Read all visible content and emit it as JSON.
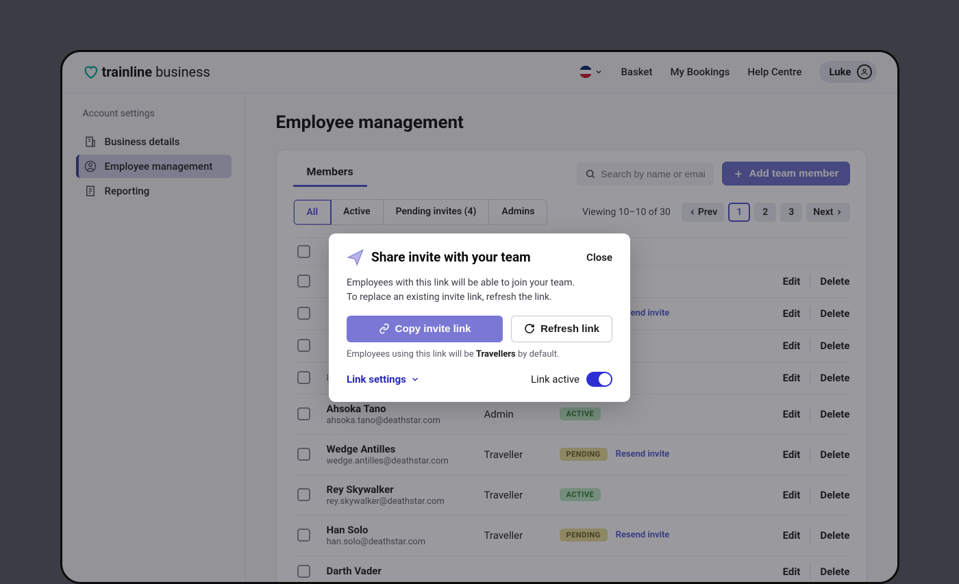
{
  "brand": {
    "primary": "trainline",
    "secondary": "business"
  },
  "topnav": {
    "basket": "Basket",
    "bookings": "My Bookings",
    "help": "Help Centre",
    "user_name": "Luke"
  },
  "sidebar": {
    "heading": "Account settings",
    "items": [
      {
        "label": "Business details"
      },
      {
        "label": "Employee management"
      },
      {
        "label": "Reporting"
      }
    ]
  },
  "page": {
    "title": "Employee management"
  },
  "members_tab": "Members",
  "search_placeholder": "Search by name or email",
  "add_button": "Add team member",
  "filters": {
    "all": "All",
    "active": "Active",
    "pending": "Pending invites (4)",
    "admins": "Admins"
  },
  "viewing": "Viewing 10–10 of 30",
  "pagination": {
    "prev": "Prev",
    "p1": "1",
    "p2": "2",
    "p3": "3",
    "next": "Next"
  },
  "actions": {
    "edit": "Edit",
    "delete": "Delete",
    "resend": "Resend invite"
  },
  "badges": {
    "active": "ACTIVE",
    "pending": "PENDING"
  },
  "rows": [
    {
      "name": "",
      "email": "",
      "role": "",
      "status": ""
    },
    {
      "name": "",
      "email": "",
      "role": "",
      "status": ""
    },
    {
      "name": "",
      "email": "",
      "role": "",
      "status": "pending"
    },
    {
      "name": "",
      "email": "",
      "role": "",
      "status": ""
    },
    {
      "name": "",
      "email": "leia.organa@deathstar.com",
      "role": "",
      "status": ""
    },
    {
      "name": "Ahsoka Tano",
      "email": "ahsoka.tano@deathstar.com",
      "role": "Admin",
      "status": "active"
    },
    {
      "name": "Wedge Antilles",
      "email": "wedge.antilles@deathstar.com",
      "role": "Traveller",
      "status": "pending"
    },
    {
      "name": "Rey Skywalker",
      "email": "rey.skywalker@deathstar.com",
      "role": "Traveller",
      "status": "active"
    },
    {
      "name": "Han Solo",
      "email": "han.solo@deathstar.com",
      "role": "Traveller",
      "status": "pending"
    },
    {
      "name": "Darth Vader",
      "email": "",
      "role": "",
      "status": ""
    }
  ],
  "modal": {
    "title": "Share invite with your team",
    "close": "Close",
    "body_line1": "Employees with this link will be able to join your team.",
    "body_line2": "To replace an existing invite link, refresh the link.",
    "copy": "Copy invite link",
    "refresh": "Refresh link",
    "hint_pre": "Employees using this link will be ",
    "hint_bold": "Travellers",
    "hint_post": " by default.",
    "link_settings": "Link settings",
    "toggle_label": "Link active"
  }
}
